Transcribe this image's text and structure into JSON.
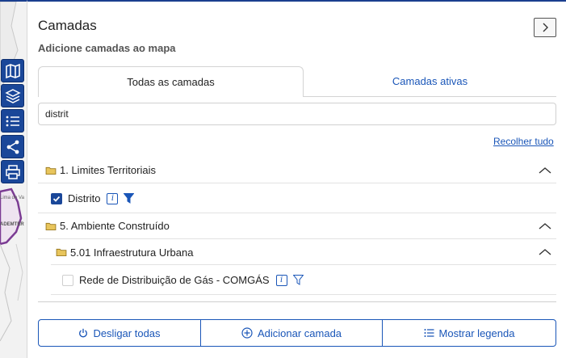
{
  "map": {
    "labels": [
      "Lima de Va",
      "ADEMTER"
    ]
  },
  "toolbar": {
    "items": [
      {
        "icon": "map-icon"
      },
      {
        "icon": "layers-icon"
      },
      {
        "icon": "list-icon"
      },
      {
        "icon": "share-icon"
      },
      {
        "icon": "print-icon"
      }
    ]
  },
  "panel": {
    "title": "Camadas",
    "subtitle": "Adicione camadas ao mapa",
    "collapse_icon": "chevron-right-icon"
  },
  "tabs": [
    {
      "label": "Todas as camadas",
      "active": true
    },
    {
      "label": "Camadas ativas",
      "active": false
    }
  ],
  "search": {
    "value": "distrit"
  },
  "collapse_all": "Recolher tudo",
  "tree": {
    "group1": {
      "label": "1. Limites Territoriais",
      "layers": [
        {
          "label": "Distrito",
          "checked": true
        }
      ]
    },
    "group2": {
      "label": "5. Ambiente Construído",
      "subgroup": {
        "label": "5.01 Infraestrutura Urbana",
        "layers": [
          {
            "label": "Rede de Distribuição de Gás - COMGÁS",
            "checked": false
          }
        ]
      }
    }
  },
  "footer": {
    "off_all": "Desligar todas",
    "add_layer": "Adicionar camada",
    "show_legend": "Mostrar legenda"
  },
  "colors": {
    "accent": "#1a4799",
    "link": "#1a56b8",
    "folder": "#e0b84a"
  }
}
